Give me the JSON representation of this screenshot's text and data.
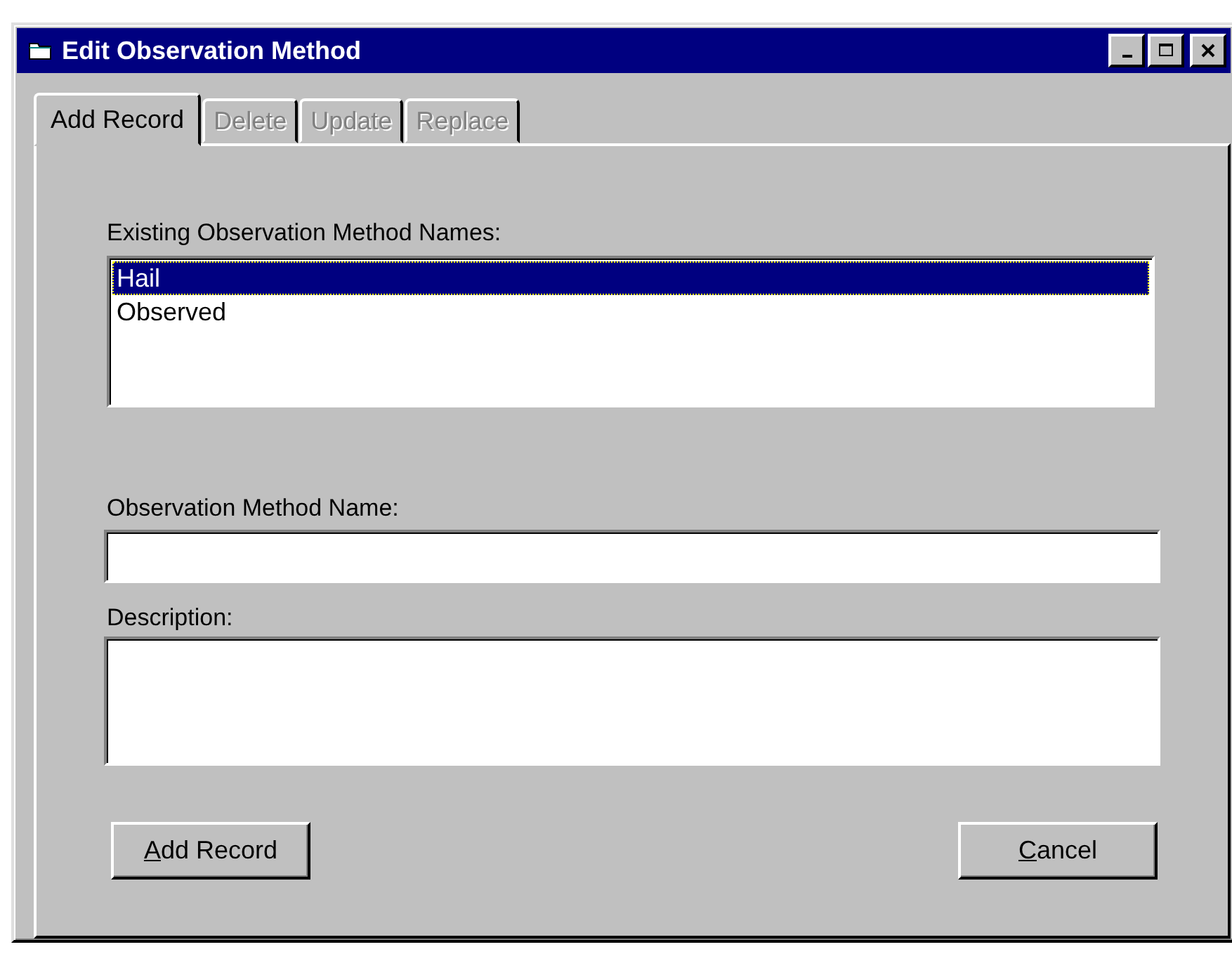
{
  "window": {
    "title": "Edit Observation Method"
  },
  "tabs": [
    {
      "label": "Add Record",
      "selected": true,
      "disabled": false
    },
    {
      "label": "Delete",
      "selected": false,
      "disabled": true
    },
    {
      "label": "Update",
      "selected": false,
      "disabled": true
    },
    {
      "label": "Replace",
      "selected": false,
      "disabled": true
    }
  ],
  "existing_list": {
    "label": "Existing Observation Method Names:",
    "items": [
      {
        "text": "Hail",
        "selected": true
      },
      {
        "text": "Observed",
        "selected": false
      }
    ]
  },
  "name_field": {
    "label": "Observation Method Name:"
  },
  "description_field": {
    "label": "Description:"
  },
  "buttons": [
    {
      "accelerator": "A",
      "rest": "dd Record"
    },
    {
      "accelerator": "C",
      "rest": "ancel"
    }
  ]
}
